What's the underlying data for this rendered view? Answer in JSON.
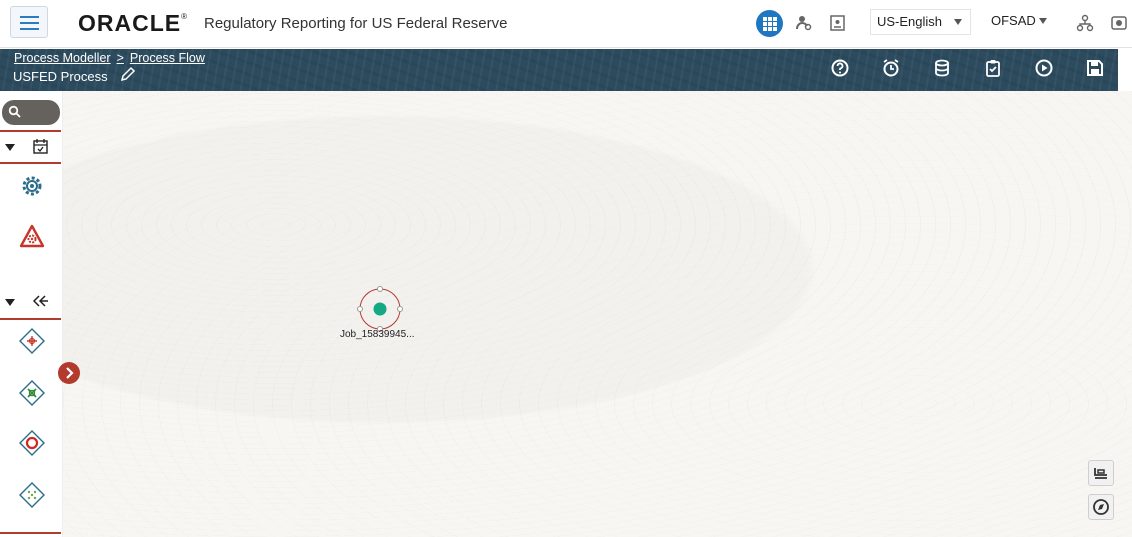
{
  "header": {
    "logo": "ORACLE",
    "logo_mark": "®",
    "app_title": "Regulatory Reporting for US Federal Reserve",
    "language": "US-English",
    "user": "OFSAD",
    "accent": "#1f77c2"
  },
  "breadcrumb": {
    "items": [
      "Process Modeller",
      "Process Flow"
    ],
    "separator": ">"
  },
  "process": {
    "name": "USFED Process"
  },
  "toolbar_icons": [
    "help-icon",
    "alarm-icon",
    "database-icon",
    "clipboard-icon",
    "run-icon",
    "save-icon"
  ],
  "palette": {
    "sections": [
      {
        "icon": "calendar-icon",
        "items": [
          "gear-icon",
          "warning-gear-icon"
        ]
      },
      {
        "icon": "double-chevron-left-icon",
        "items": [
          "diamond-plus-icon",
          "diamond-cross-icon",
          "diamond-circle-icon",
          "diamond-dots-icon"
        ]
      }
    ],
    "accent": "#b23b2e"
  },
  "canvas": {
    "nodes": [
      {
        "label": "Job_15839945...",
        "color": "#14a884"
      }
    ]
  }
}
